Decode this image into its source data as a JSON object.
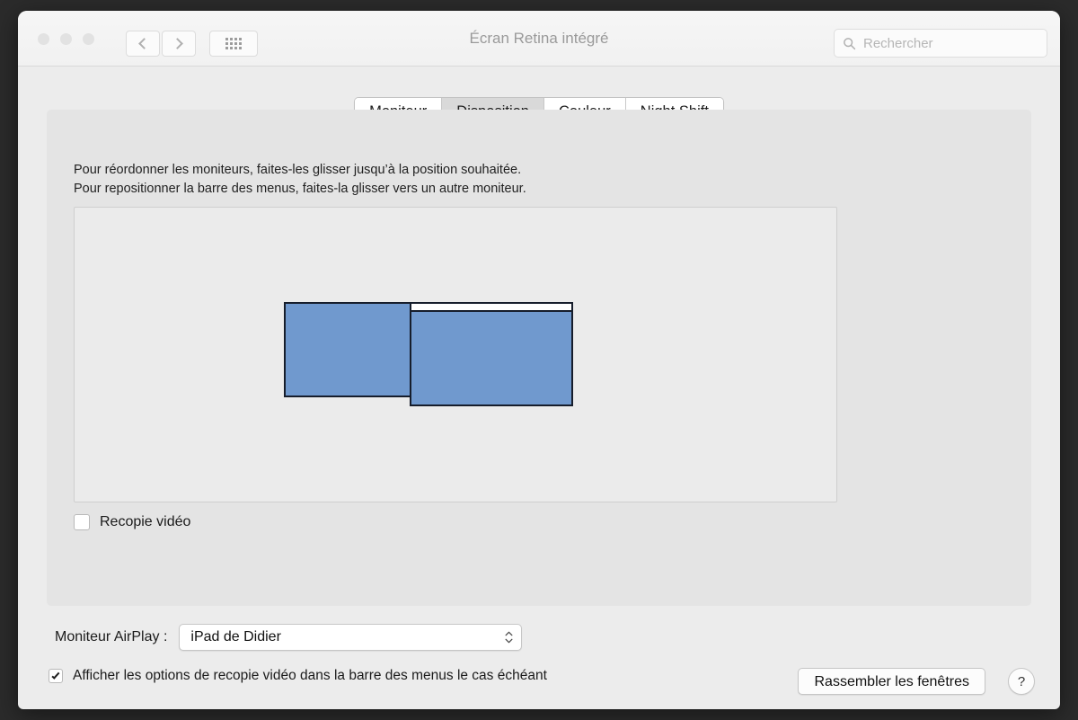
{
  "window": {
    "title": "Écran Retina intégré",
    "traffic_lights": [
      "close",
      "minimize",
      "maximize"
    ],
    "nav": {
      "back_icon": "chevron-left-icon",
      "forward_icon": "chevron-right-icon",
      "grid_icon": "grid-icon"
    }
  },
  "search": {
    "placeholder": "Rechercher",
    "value": "",
    "icon": "search-icon"
  },
  "tabs": [
    {
      "label": "Moniteur",
      "active": false
    },
    {
      "label": "Disposition",
      "active": true
    },
    {
      "label": "Couleur",
      "active": false
    },
    {
      "label": "Night Shift",
      "active": false
    }
  ],
  "panel": {
    "instructions_line1": "Pour réordonner les moniteurs, faites-les glisser jusqu’à la position souhaitée.",
    "instructions_line2": "Pour repositionner la barre des menus, faites-la glisser vers un autre moniteur.",
    "arrangement": {
      "monitors": [
        {
          "name": "display-left",
          "has_menubar": false
        },
        {
          "name": "display-right",
          "has_menubar": true
        }
      ]
    },
    "mirror_checkbox": {
      "label": "Recopie vidéo",
      "checked": false
    }
  },
  "airplay": {
    "label": "Moniteur AirPlay :",
    "selected": "iPad de Didier"
  },
  "footer": {
    "show_mirroring_options": {
      "label": "Afficher les options de recopie vidéo dans la barre des menus le cas échéant",
      "checked": true
    },
    "gather_windows_button": "Rassembler les fenêtres",
    "help_button": "?"
  },
  "colors": {
    "monitor_blue": "#7099ce",
    "monitor_border": "#161d2b",
    "window_bg": "#ececec",
    "panel_bg": "#e4e4e4",
    "tab_active_bg": "#d9d9d9"
  }
}
